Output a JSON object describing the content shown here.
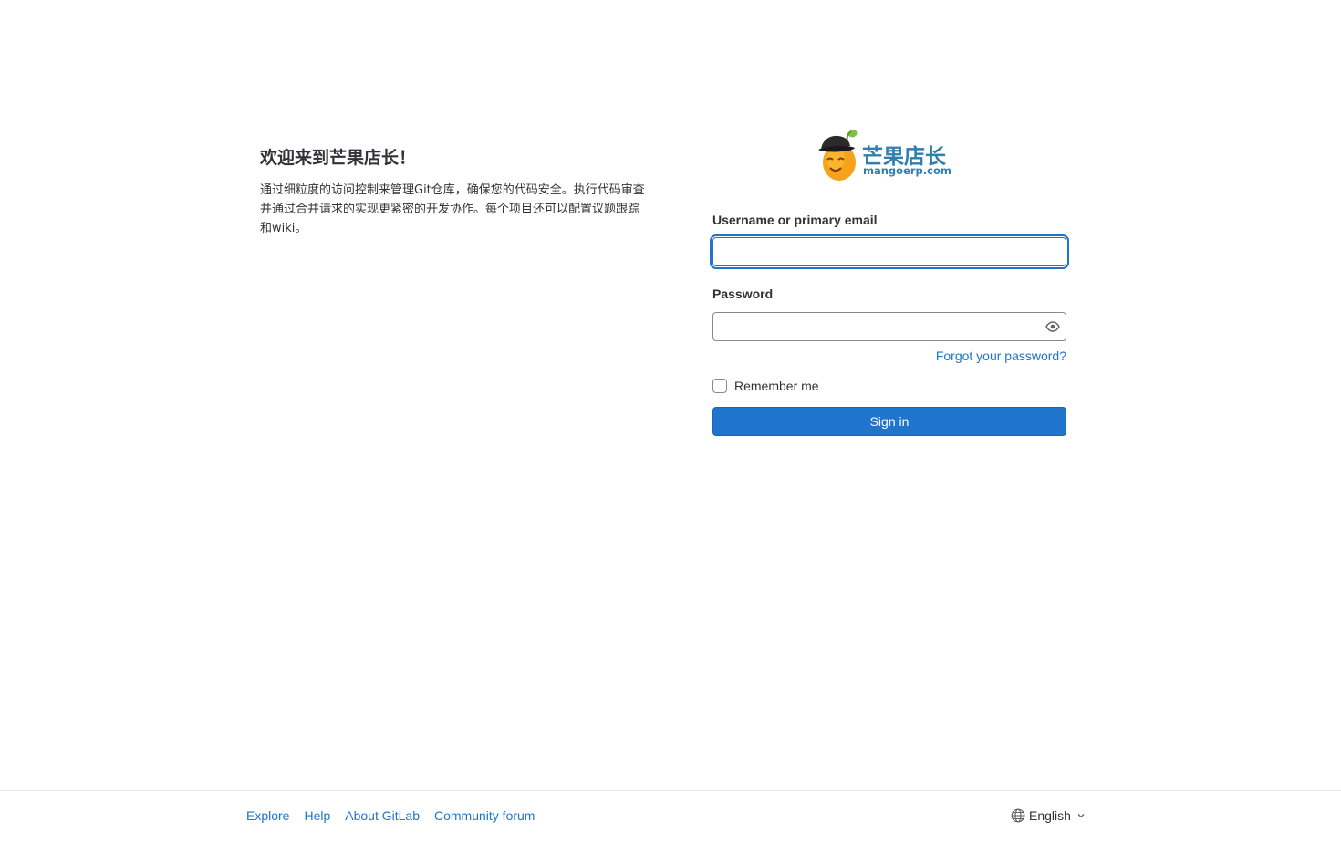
{
  "intro": {
    "heading": "欢迎来到芒果店长！",
    "description": "通过细粒度的访问控制来管理Git仓库，确保您的代码安全。执行代码审查并通过合并请求的实现更紧密的开发协作。每个项目还可以配置议题跟踪和wiki。"
  },
  "logo": {
    "name_cn": "芒果店长",
    "domain": "mangoerp.com",
    "brand_color": "#2f7fb0"
  },
  "login_form": {
    "username_label": "Username or primary email",
    "username_value": "",
    "password_label": "Password",
    "password_value": "",
    "show_password_icon": "eye-icon",
    "forgot_password": "Forgot your password?",
    "remember_me": "Remember me",
    "remember_checked": false,
    "sign_in": "Sign in",
    "accent_color": "#1f75cb"
  },
  "footer": {
    "links": [
      "Explore",
      "Help",
      "About GitLab",
      "Community forum"
    ],
    "language": "English",
    "language_icon": "globe-icon",
    "dropdown_icon": "chevron-down-icon"
  }
}
